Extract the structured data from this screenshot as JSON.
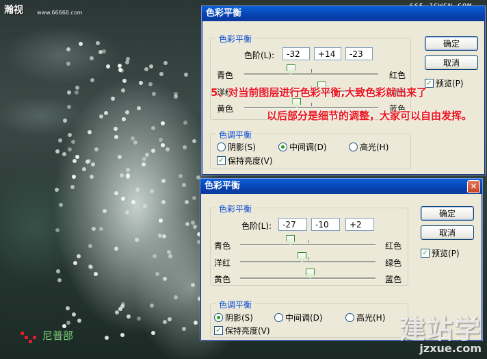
{
  "header": {
    "logo_text": "瀚视",
    "url_left": "www.66666.com",
    "url_right": "665.JCWCN.COM"
  },
  "dialog_top": {
    "title": "色彩平衡",
    "color_balance_group": "色彩平衡",
    "levels_label": "色阶(L):",
    "levels": [
      "-32",
      "+14",
      "-23"
    ],
    "slider_rows": [
      {
        "left": "青色",
        "right": "红色",
        "value": -32
      },
      {
        "left": "洋红",
        "right": "绿色",
        "value": 14
      },
      {
        "left": "黄色",
        "right": "蓝色",
        "value": -23
      }
    ],
    "tone_group": "色调平衡",
    "tone_options": [
      "阴影(S)",
      "中间调(D)",
      "高光(H)"
    ],
    "tone_selected": 1,
    "preserve_luminosity": "保持亮度(V)",
    "ok": "确定",
    "cancel": "取消",
    "preview": "预览(P)"
  },
  "dialog_bottom": {
    "title": "色彩平衡",
    "color_balance_group": "色彩平衡",
    "levels_label": "色阶(L):",
    "levels": [
      "-27",
      "-10",
      "+2"
    ],
    "slider_rows": [
      {
        "left": "青色",
        "right": "红色",
        "value": -27
      },
      {
        "left": "洋红",
        "right": "绿色",
        "value": -10
      },
      {
        "left": "黄色",
        "right": "蓝色",
        "value": 2
      }
    ],
    "tone_group": "色调平衡",
    "tone_options": [
      "阴影(S)",
      "中间调(D)",
      "高光(H)"
    ],
    "tone_selected": 0,
    "preserve_luminosity": "保持亮度(V)",
    "ok": "确定",
    "cancel": "取消",
    "preview": "预览(P)"
  },
  "annotation": {
    "line1": "5、对当前图层进行色彩平衡,大致色彩就出来了",
    "line2": "以后部分是细节的调整，大家可以自由发挥。"
  },
  "watermarks": {
    "brand_big": "建站学",
    "brand_small": "jzxue.com",
    "bottom_left": "尼普部"
  }
}
